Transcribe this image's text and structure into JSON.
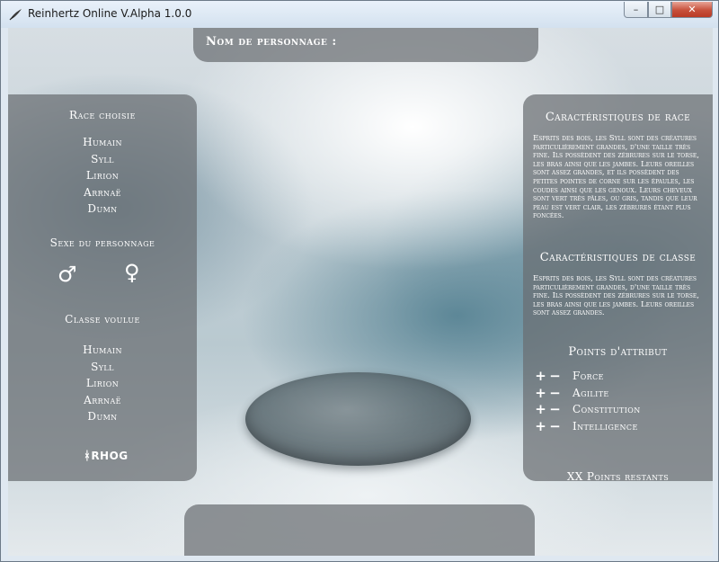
{
  "window": {
    "title": "Reinhertz Online V.Alpha 1.0.0",
    "buttons": {
      "minimize": "–",
      "maximize": "□",
      "close": "✕"
    }
  },
  "character_name": {
    "label": "Nom de personnage :"
  },
  "race": {
    "heading": "Race choisie",
    "options": [
      "Humain",
      "Syll",
      "Lirion",
      "Arrnaë",
      "Dumn"
    ]
  },
  "gender": {
    "heading": "Sexe du personnage",
    "male_icon": "male-symbol",
    "female_icon": "female-symbol",
    "male_glyph": "♂",
    "female_glyph": "♀"
  },
  "class": {
    "heading": "Classe voulue",
    "options": [
      "Humain",
      "Syll",
      "Lirion",
      "Arrnaë",
      "Dumn"
    ]
  },
  "logo": {
    "text": "RHOG"
  },
  "race_traits": {
    "heading": "Caractéristiques de race",
    "text": "Esprits des bois, les Syll sont des créatures particulièrement grandes, d'une taille très fine. Ils possèdent des zébrures sur le torse, les bras ainsi que les jambes. Leurs oreilles sont assez grandes, et ils possèdent des petites pointes de corne sur les épaules, les coudes ainsi que les genoux. Leurs cheveux sont vert très pâles, ou gris, tandis que leur peau est vert clair, les zébrures étant plus foncées."
  },
  "class_traits": {
    "heading": "Caractéristiques de classe",
    "text": "Esprits des bois, les Syll sont des créatures particulièrement grandes, d'une taille très fine. Ils possèdent des zébrures sur le torse, les bras ainsi que les jambes. Leurs oreilles sont assez grandes."
  },
  "attributes": {
    "heading": "Points d'attribut",
    "plus": "+",
    "minus": "−",
    "items": [
      "Force",
      "Agilite",
      "Constitution",
      "Intelligence"
    ],
    "points_left": "XX Points restants"
  }
}
